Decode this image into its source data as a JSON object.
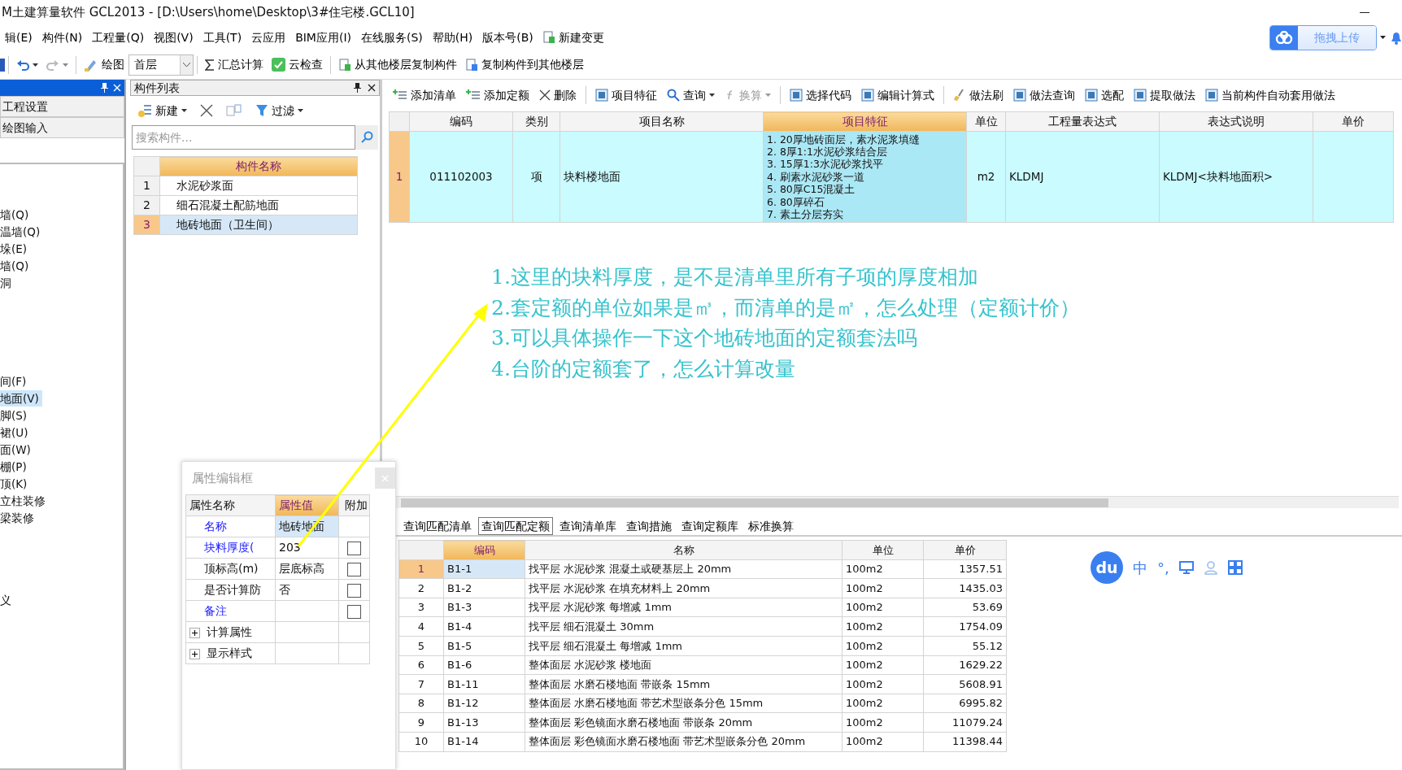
{
  "window": {
    "title": "M土建算量软件 GCL2013 - [D:\\Users\\home\\Desktop\\3#住宅楼.GCL10]"
  },
  "menu": [
    "辑(E)",
    "构件(N)",
    "工程量(Q)",
    "视图(V)",
    "工具(T)",
    "云应用",
    "BIM应用(I)",
    "在线服务(S)",
    "帮助(H)",
    "版本号(B)"
  ],
  "menu_action": "新建变更",
  "cloud_upload": {
    "label": "拖拽上传"
  },
  "toolbar": {
    "draw": "绘图",
    "floor": "首层",
    "buttons": [
      "汇总计算",
      "云检查",
      "从其他楼层复制构件",
      "复制构件到其他楼层"
    ]
  },
  "nav_panel": {
    "items": [
      "工程设置",
      "绘图输入"
    ],
    "tree_groups": [
      {
        "items": [
          {
            "label": "墙(Q)",
            "selected": false
          },
          {
            "label": "温墙(Q)",
            "selected": false
          },
          {
            "label": "垛(E)",
            "selected": false
          },
          {
            "label": "墙(Q)",
            "selected": false
          },
          {
            "label": "洞",
            "selected": false
          }
        ]
      },
      {
        "items": [
          {
            "label": "间(F)",
            "selected": false
          },
          {
            "label": "地面(V)",
            "selected": true
          },
          {
            "label": "脚(S)",
            "selected": false
          },
          {
            "label": "裙(U)",
            "selected": false
          },
          {
            "label": "面(W)",
            "selected": false
          },
          {
            "label": "棚(P)",
            "selected": false
          },
          {
            "label": "顶(K)",
            "selected": false
          },
          {
            "label": "立柱装修",
            "selected": false
          },
          {
            "label": "梁装修",
            "selected": false
          }
        ]
      },
      {
        "items": [
          {
            "label": "义",
            "selected": false
          }
        ]
      }
    ]
  },
  "component_list": {
    "title": "构件列表",
    "new_label": "新建",
    "filter_label": "过滤",
    "search": {
      "placeholder": "搜索构件..."
    },
    "column": "构件名称",
    "rows": [
      {
        "num": "1",
        "name": "水泥砂浆面",
        "selected": false
      },
      {
        "num": "2",
        "name": "细石混凝土配筋地面",
        "selected": false
      },
      {
        "num": "3",
        "name": "地砖地面（卫生间）",
        "selected": true
      }
    ]
  },
  "method_toolbar": [
    {
      "label": "添加清单",
      "disabled": false,
      "dropdown": false
    },
    {
      "label": "添加定额",
      "disabled": false,
      "dropdown": false
    },
    {
      "label": "删除",
      "disabled": false,
      "dropdown": false
    },
    {
      "label": "项目特征",
      "disabled": false,
      "dropdown": false
    },
    {
      "label": "查询",
      "disabled": false,
      "dropdown": true
    },
    {
      "label": "换算",
      "disabled": true,
      "dropdown": true
    },
    {
      "label": "选择代码",
      "disabled": false,
      "dropdown": false
    },
    {
      "label": "编辑计算式",
      "disabled": false,
      "dropdown": false
    },
    {
      "label": "做法刷",
      "disabled": false,
      "dropdown": false
    },
    {
      "label": "做法查询",
      "disabled": false,
      "dropdown": false
    },
    {
      "label": "选配",
      "disabled": false,
      "dropdown": false
    },
    {
      "label": "提取做法",
      "disabled": false,
      "dropdown": false
    },
    {
      "label": "当前构件自动套用做法",
      "disabled": false,
      "dropdown": false
    }
  ],
  "bill_grid": {
    "columns": [
      {
        "label": "编码",
        "selected": false
      },
      {
        "label": "类别",
        "selected": false
      },
      {
        "label": "项目名称",
        "selected": false
      },
      {
        "label": "项目特征",
        "selected": true
      },
      {
        "label": "单位",
        "selected": false
      },
      {
        "label": "工程量表达式",
        "selected": false
      },
      {
        "label": "表达式说明",
        "selected": false
      },
      {
        "label": "单价",
        "selected": false
      }
    ],
    "rows": [
      {
        "num": "1",
        "code": "011102003",
        "type": "项",
        "name": "块料楼地面",
        "features": [
          "1. 20厚地砖面层，素水泥浆填缝",
          "2. 8厚1:1水泥砂浆结合层",
          "3. 15厚1:3水泥砂浆找平",
          "4. 刷素水泥砂浆一道",
          "5. 80厚C15混凝土",
          "6. 80厚碎石",
          "7. 素土分层夯实"
        ],
        "unit": "m2",
        "expression": "KLDMJ",
        "expression_note": "KLDMJ<块料地面积>"
      }
    ]
  },
  "annotation": {
    "lines": [
      "1.这里的块料厚度，是不是清单里所有子项的厚度相加",
      "2.套定额的单位如果是㎥，而清单的是㎡，怎么处理（定额计价）",
      "3.可以具体操作一下这个地砖地面的定额套法吗",
      "4.台阶的定额套了，怎么计算改量"
    ]
  },
  "query_tabs": [
    {
      "label": "查询匹配清单",
      "selected": false
    },
    {
      "label": "查询匹配定额",
      "selected": true
    },
    {
      "label": "查询清单库",
      "selected": false
    },
    {
      "label": "查询措施",
      "selected": false
    },
    {
      "label": "查询定额库",
      "selected": false
    },
    {
      "label": "标准换算",
      "selected": false
    }
  ],
  "quota_grid": {
    "columns": [
      {
        "label": "编码",
        "selected": true
      },
      {
        "label": "名称",
        "selected": false
      },
      {
        "label": "单位",
        "selected": false
      },
      {
        "label": "单价",
        "selected": false
      }
    ],
    "rows": [
      {
        "num": "1",
        "code": "B1-1",
        "name": "找平层 水泥砂浆 混凝土或硬基层上 20mm",
        "unit": "100m2",
        "price": "1357.51",
        "selected": true
      },
      {
        "num": "2",
        "code": "B1-2",
        "name": "找平层 水泥砂浆 在填充材料上 20mm",
        "unit": "100m2",
        "price": "1435.03",
        "selected": false
      },
      {
        "num": "3",
        "code": "B1-3",
        "name": "找平层 水泥砂浆 每增减 1mm",
        "unit": "100m2",
        "price": "53.69",
        "selected": false
      },
      {
        "num": "4",
        "code": "B1-4",
        "name": "找平层 细石混凝土 30mm",
        "unit": "100m2",
        "price": "1754.09",
        "selected": false
      },
      {
        "num": "5",
        "code": "B1-5",
        "name": "找平层 细石混凝土 每增减 1mm",
        "unit": "100m2",
        "price": "55.12",
        "selected": false
      },
      {
        "num": "6",
        "code": "B1-6",
        "name": "整体面层 水泥砂浆 楼地面",
        "unit": "100m2",
        "price": "1629.22",
        "selected": false
      },
      {
        "num": "7",
        "code": "B1-11",
        "name": "整体面层 水磨石楼地面 带嵌条 15mm",
        "unit": "100m2",
        "price": "5608.91",
        "selected": false
      },
      {
        "num": "8",
        "code": "B1-12",
        "name": "整体面层 水磨石楼地面 带艺术型嵌条分色 15mm",
        "unit": "100m2",
        "price": "6995.82",
        "selected": false
      },
      {
        "num": "9",
        "code": "B1-13",
        "name": "整体面层 彩色镜面水磨石楼地面 带嵌条 20mm",
        "unit": "100m2",
        "price": "11079.24",
        "selected": false
      },
      {
        "num": "10",
        "code": "B1-14",
        "name": "整体面层 彩色镜面水磨石楼地面 带艺术型嵌条分色 20mm",
        "unit": "100m2",
        "price": "11398.44",
        "selected": false
      }
    ]
  },
  "property_editor": {
    "title": "属性编辑框",
    "columns": [
      "属性名称",
      "属性值",
      "附加"
    ],
    "rows": [
      {
        "kind": "property",
        "name": "名称",
        "value": "地砖地面",
        "public": true
      },
      {
        "kind": "property",
        "name": "块料厚度(",
        "value": "203",
        "public": true,
        "checked": false
      },
      {
        "kind": "property",
        "name": "顶标高(m)",
        "value": "层底标高",
        "public": false,
        "checked": false
      },
      {
        "kind": "property",
        "name": "是否计算防",
        "value": "否",
        "public": false,
        "checked": false
      },
      {
        "kind": "property",
        "name": "备注",
        "public": true,
        "checked": false
      },
      {
        "kind": "group",
        "name": "计算属性",
        "expanded": false
      },
      {
        "kind": "group",
        "name": "显示样式",
        "expanded": false
      }
    ]
  },
  "input_bar": {
    "logo": "du",
    "mode": "中",
    "punctuation": "°,"
  }
}
